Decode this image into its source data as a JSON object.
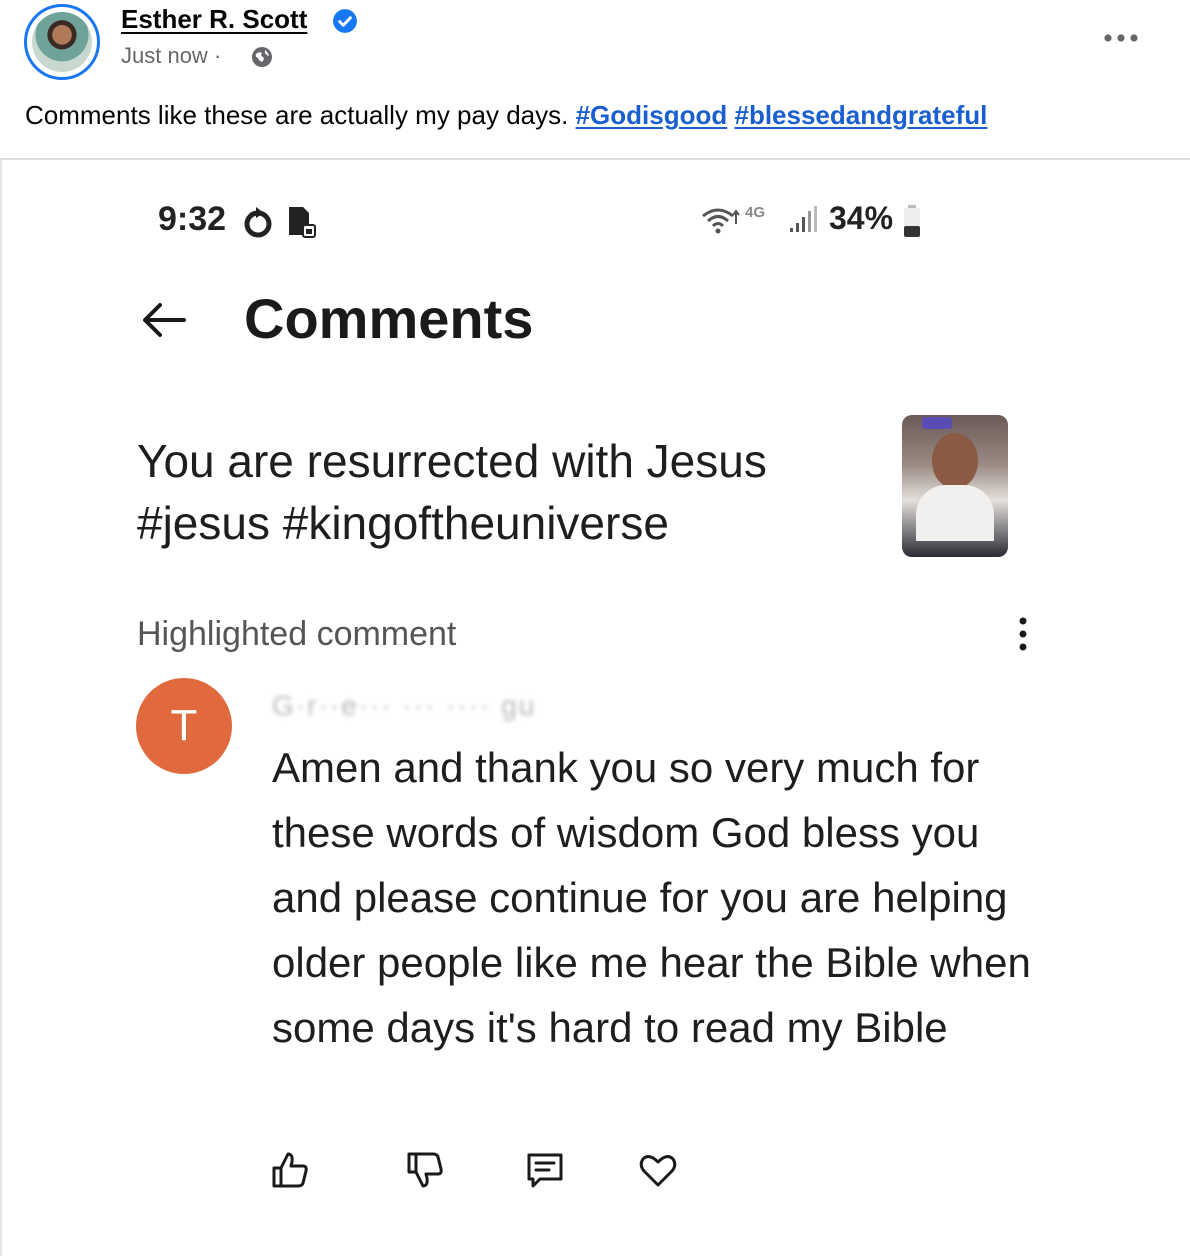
{
  "post": {
    "author": "Esther R. Scott",
    "time": "Just now",
    "separator": "·",
    "text": "Comments like these are actually my pay days.",
    "hashtags": [
      "#Godisgood",
      "#blessedandgrateful"
    ]
  },
  "screenshot": {
    "status_bar": {
      "time": "9:32",
      "network": "4G",
      "battery": "34%"
    },
    "title": "Comments",
    "video_title": "You are resurrected with  Jesus #jesus #kingoftheuniverse",
    "highlight_label": "Highlighted comment",
    "comment": {
      "avatar_letter": "T",
      "blurred_name": "G·r··e··· ··· ···· gu",
      "text": "Amen and thank you so very much for these words of wisdom God bless you and please continue for you are helping older people like me hear the Bible when some days it's hard to read my Bible"
    }
  },
  "icons": {
    "verified": "verified-badge-icon",
    "privacy": "globe-icon",
    "more": "more-horizontal-icon",
    "back": "arrow-left-icon",
    "options": "more-vertical-icon",
    "like": "thumbs-up-icon",
    "dislike": "thumbs-down-icon",
    "reply": "comment-icon",
    "heart": "heart-icon"
  },
  "colors": {
    "accent": "#1877f2",
    "hashtag": "#1a5fd0",
    "commenter_avatar": "#e06a3d"
  }
}
